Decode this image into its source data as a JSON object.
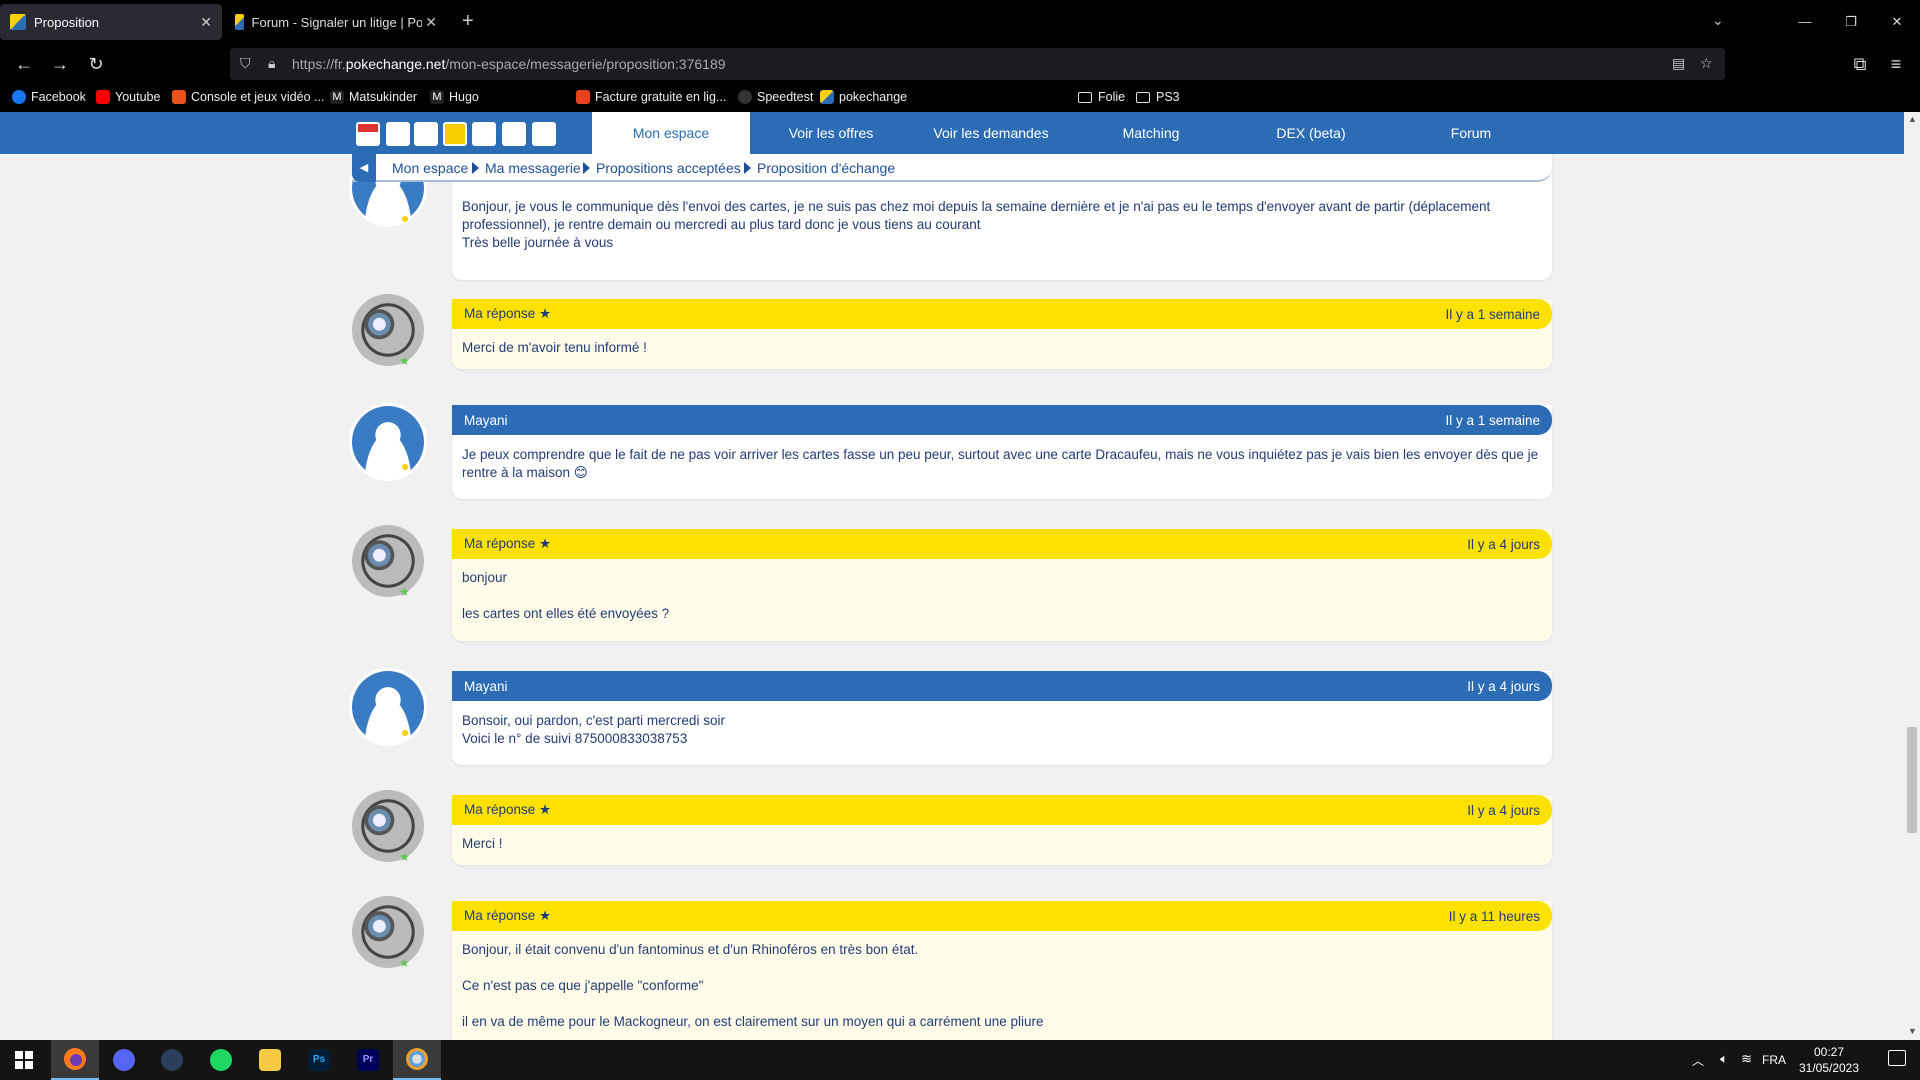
{
  "browser": {
    "tabs": [
      {
        "title": "Proposition",
        "active": true
      },
      {
        "title": "Forum - Signaler un litige | Poke",
        "active": false
      }
    ],
    "url_prefix": "https://fr.",
    "url_domain": "pokechange.net",
    "url_path": "/mon-espace/messagerie/proposition:376189",
    "bookmarks": [
      "Facebook",
      "Youtube",
      "Console et jeux vidéo ...",
      "Matsukinder",
      "Hugo",
      "Facture gratuite en lig...",
      "Speedtest",
      "pokechange"
    ],
    "bookmark_folders": [
      "Folie",
      "PS3"
    ]
  },
  "site_nav": {
    "links": [
      "Mon espace",
      "Voir les offres",
      "Voir les demandes",
      "Matching",
      "DEX (beta)",
      "Forum"
    ],
    "active": "Mon espace"
  },
  "breadcrumb": [
    "Mon espace",
    "Ma messagerie",
    "Propositions acceptées",
    "Proposition d'échange"
  ],
  "messages": [
    {
      "partial": true,
      "lines": [
        "Bonjour, je vous le communique dès l'envoi des cartes, je ne suis pas chez moi depuis la semaine dernière et je n'ai pas eu le temps d'envoyer avant de partir (déplacement professionnel), je rentre demain ou mercredi au plus tard donc je vous tiens au courant",
        "Très belle journée à vous"
      ]
    },
    {
      "author": "Ma réponse ★",
      "time": "Il y a 1 semaine",
      "mine": true,
      "lines": [
        "Merci de m'avoir tenu informé !"
      ]
    },
    {
      "author": "Mayani",
      "time": "Il y a 1 semaine",
      "mine": false,
      "lines": [
        "Je peux comprendre que le fait de ne pas voir arriver les cartes fasse un peu peur, surtout avec une carte Dracaufeu, mais ne vous inquiétez pas je vais bien les envoyer dès que je rentre à la maison 😊"
      ]
    },
    {
      "author": "Ma réponse ★",
      "time": "Il y a 4 jours",
      "mine": true,
      "lines": [
        "bonjour",
        "",
        "les cartes ont elles été envoyées ?"
      ]
    },
    {
      "author": "Mayani",
      "time": "Il y a 4 jours",
      "mine": false,
      "lines": [
        "Bonsoir, oui pardon, c'est parti mercredi soir",
        "Voici le n° de suivi 875000833038753"
      ]
    },
    {
      "author": "Ma réponse ★",
      "time": "Il y a 4 jours",
      "mine": true,
      "lines": [
        "Merci !"
      ]
    },
    {
      "author": "Ma réponse ★",
      "time": "Il y a 11 heures",
      "mine": true,
      "lines": [
        "Bonjour, il était convenu d'un fantominus et d'un Rhinoféros en très bon état.",
        "",
        "Ce n'est pas ce que j'appelle \"conforme\"",
        "",
        "il en va de même pour le Mackogneur, on est clairement sur un moyen qui a carrément une pliure"
      ]
    }
  ],
  "taskbar": {
    "language": "FRA",
    "time": "00:27",
    "date": "31/05/2023"
  },
  "colors": {
    "brand_blue": "#2c6cb5",
    "brand_yellow": "#fde100",
    "text_blue": "#233c75"
  }
}
